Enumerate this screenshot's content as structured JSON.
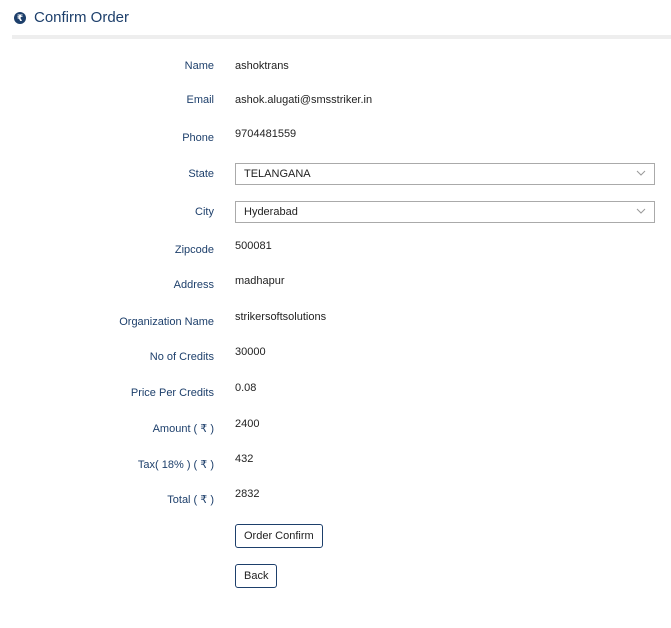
{
  "header": {
    "icon": "rupee-circle-icon",
    "title": "Confirm Order"
  },
  "fields": {
    "name": {
      "label": "Name",
      "value": "ashoktrans"
    },
    "email": {
      "label": "Email",
      "value": "ashok.alugati@smsstriker.in"
    },
    "phone": {
      "label": "Phone",
      "value": "9704481559"
    },
    "state": {
      "label": "State",
      "value": "TELANGANA"
    },
    "city": {
      "label": "City",
      "value": "Hyderabad"
    },
    "zipcode": {
      "label": "Zipcode",
      "value": "500081"
    },
    "address": {
      "label": "Address",
      "value": "madhapur"
    },
    "organization": {
      "label": "Organization Name",
      "value": "strikersoftsolutions"
    },
    "credits": {
      "label": "No of Credits",
      "value": "30000"
    },
    "price": {
      "label": "Price Per Credits",
      "value": "0.08"
    },
    "amount": {
      "label": "Amount ( ₹ )",
      "value": "2400"
    },
    "tax": {
      "label": "Tax( 18% ) ( ₹ )",
      "value": "432"
    },
    "total": {
      "label": "Total ( ₹ )",
      "value": "2832"
    }
  },
  "buttons": {
    "confirm": "Order Confirm",
    "back": "Back"
  },
  "colors": {
    "accent": "#1d3f6b",
    "label": "#1d3f6b",
    "border": "#aaaaaa"
  }
}
